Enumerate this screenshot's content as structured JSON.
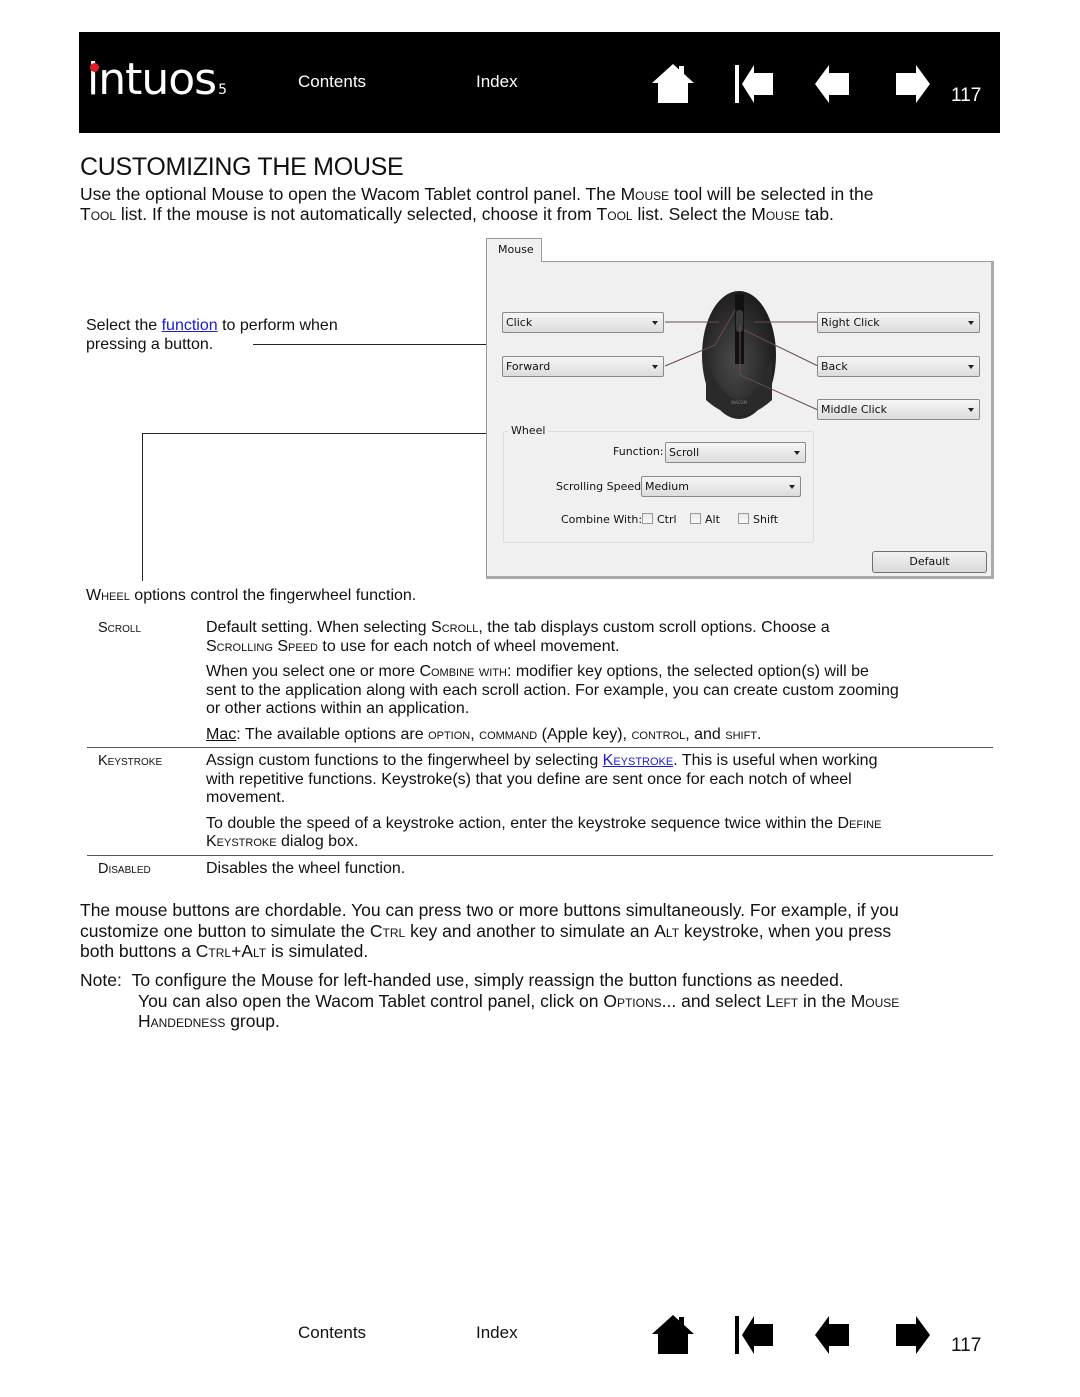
{
  "header": {
    "logo_text": "intuos",
    "logo_version": "5",
    "nav_contents": "Contents",
    "nav_index": "Index",
    "icons": [
      "home-icon",
      "first-page-icon",
      "previous-page-icon",
      "next-page-icon"
    ],
    "page_number": "117"
  },
  "title": "CUSTOMIZING THE MOUSE",
  "intro": {
    "p1_a": "Use the optional Mouse to open the Wacom Tablet control panel.  The ",
    "p1_sc1": "Mouse",
    "p1_b": " tool will be selected in the",
    "p2_sc1": "Tool",
    "p2_a": " list.  If the mouse is not automatically selected, choose it from ",
    "p2_sc2": "Tool",
    "p2_b": " list.  Select the ",
    "p2_sc3": "Mouse",
    "p2_c": " tab."
  },
  "annotation": {
    "select_a": "Select the ",
    "select_link": "function",
    "select_b": " to perform when",
    "select_c": "pressing a button.",
    "wheel_sc": "Wheel",
    "wheel_rest": " options control the fingerwheel function."
  },
  "dialog": {
    "tab_label": "Mouse",
    "left_top_button": "Click",
    "left_bottom_button": "Forward",
    "right_top_button": "Right Click",
    "right_middle_button": "Back",
    "right_bottom_button": "Middle Click",
    "wheel_group_title": "Wheel",
    "function_label": "Function:",
    "function_value": "Scroll",
    "speed_label": "Scrolling Speed:",
    "speed_value": "Medium",
    "combine_label": "Combine With:",
    "combine_options": [
      {
        "label": "Ctrl",
        "checked": false
      },
      {
        "label": "Alt",
        "checked": false
      },
      {
        "label": "Shift",
        "checked": false
      }
    ],
    "default_button": "Default",
    "mouse_brand": "WACOM"
  },
  "table": {
    "rows": [
      {
        "term": "Scroll",
        "d1_a": "Default setting.  When selecting ",
        "d1_sc": "Scroll",
        "d1_b": ", the tab displays custom scroll options.  Choose a",
        "d1_sc2": "Scrolling Speed",
        "d1_c": " to use for each notch of wheel movement.",
        "d2_a": "When you select one or more ",
        "d2_sc": "Combine with",
        "d2_b": ": modifier key options, the selected option(s) will be",
        "d2_c": "sent to the application along with each scroll action.  For example, you can create custom zooming",
        "d2_d": "or other actions within an application.",
        "d3_link": "Mac",
        "d3_a": ": The available options are ",
        "d3_sc1": "option",
        "d3_b": ", ",
        "d3_sc2": "command",
        "d3_c": " (Apple key), ",
        "d3_sc3": "control",
        "d3_d": ", and ",
        "d3_sc4": "shift",
        "d3_e": "."
      },
      {
        "term": "Keystroke",
        "d1_a": "Assign custom functions to the fingerwheel by selecting ",
        "d1_link": "Keystroke",
        "d1_b": ".  This is useful when working",
        "d1_c": "with repetitive functions.  Keystroke(s) that you define are sent once for each notch of wheel",
        "d1_d": "movement.",
        "d2_a": "To double the speed of a keystroke action, enter the keystroke sequence twice within the ",
        "d2_sc": "Define",
        "d2_sc2": "Keystroke",
        "d2_b": " dialog box."
      },
      {
        "term": "Disabled",
        "d1": "Disables the wheel function."
      }
    ]
  },
  "chordable": {
    "l1": "The mouse buttons are chordable.  You can press two or more buttons simultaneously.  For example, if you",
    "l2_a": "customize one button to simulate the ",
    "l2_sc1": "Ctrl",
    "l2_b": " key and another to simulate an ",
    "l2_sc2": "Alt",
    "l2_c": " keystroke, when you press",
    "l3_a": "both buttons a ",
    "l3_sc": "Ctrl+Alt",
    "l3_b": " is simulated."
  },
  "note": {
    "label": "Note:",
    "l1": "To configure the Mouse for left-handed use, simply reassign the button functions as needed.",
    "l2_a": "You can also open the Wacom Tablet control panel, click on ",
    "l2_sc1": "Options",
    "l2_b": "... and select ",
    "l2_sc2": "Left",
    "l2_c": " in the ",
    "l2_sc3": "Mouse",
    "l3_sc": "Handedness",
    "l3_b": " group."
  },
  "footer": {
    "nav_contents": "Contents",
    "nav_index": "Index",
    "page_number": "117"
  }
}
